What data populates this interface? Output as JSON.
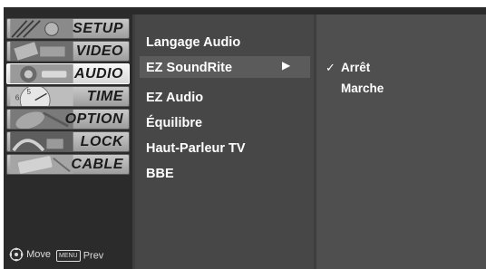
{
  "left_menu": {
    "items": [
      {
        "label": "SETUP",
        "icon": "setup-thumbnail-icon"
      },
      {
        "label": "VIDEO",
        "icon": "video-thumbnail-icon"
      },
      {
        "label": "AUDIO",
        "icon": "audio-thumbnail-icon"
      },
      {
        "label": "TIME",
        "icon": "time-clock-thumbnail-icon"
      },
      {
        "label": "OPTION",
        "icon": "option-thumbnail-icon"
      },
      {
        "label": "LOCK",
        "icon": "lock-thumbnail-icon"
      },
      {
        "label": "CABLE",
        "icon": "cable-thumbnail-icon"
      }
    ],
    "selected": "AUDIO"
  },
  "hints": {
    "move_label": "Move",
    "menu_badge": "MENU",
    "prev_label": "Prev"
  },
  "submenu": {
    "items": [
      "Langage Audio",
      "EZ SoundRite",
      "EZ Audio",
      "Équilibre",
      "Haut-Parleur TV",
      "BBE"
    ],
    "selected": "EZ SoundRite",
    "arrow": "▶"
  },
  "options": {
    "items": [
      "Arrêt",
      "Marche"
    ],
    "checked": "Arrêt",
    "check_mark": "✓"
  }
}
